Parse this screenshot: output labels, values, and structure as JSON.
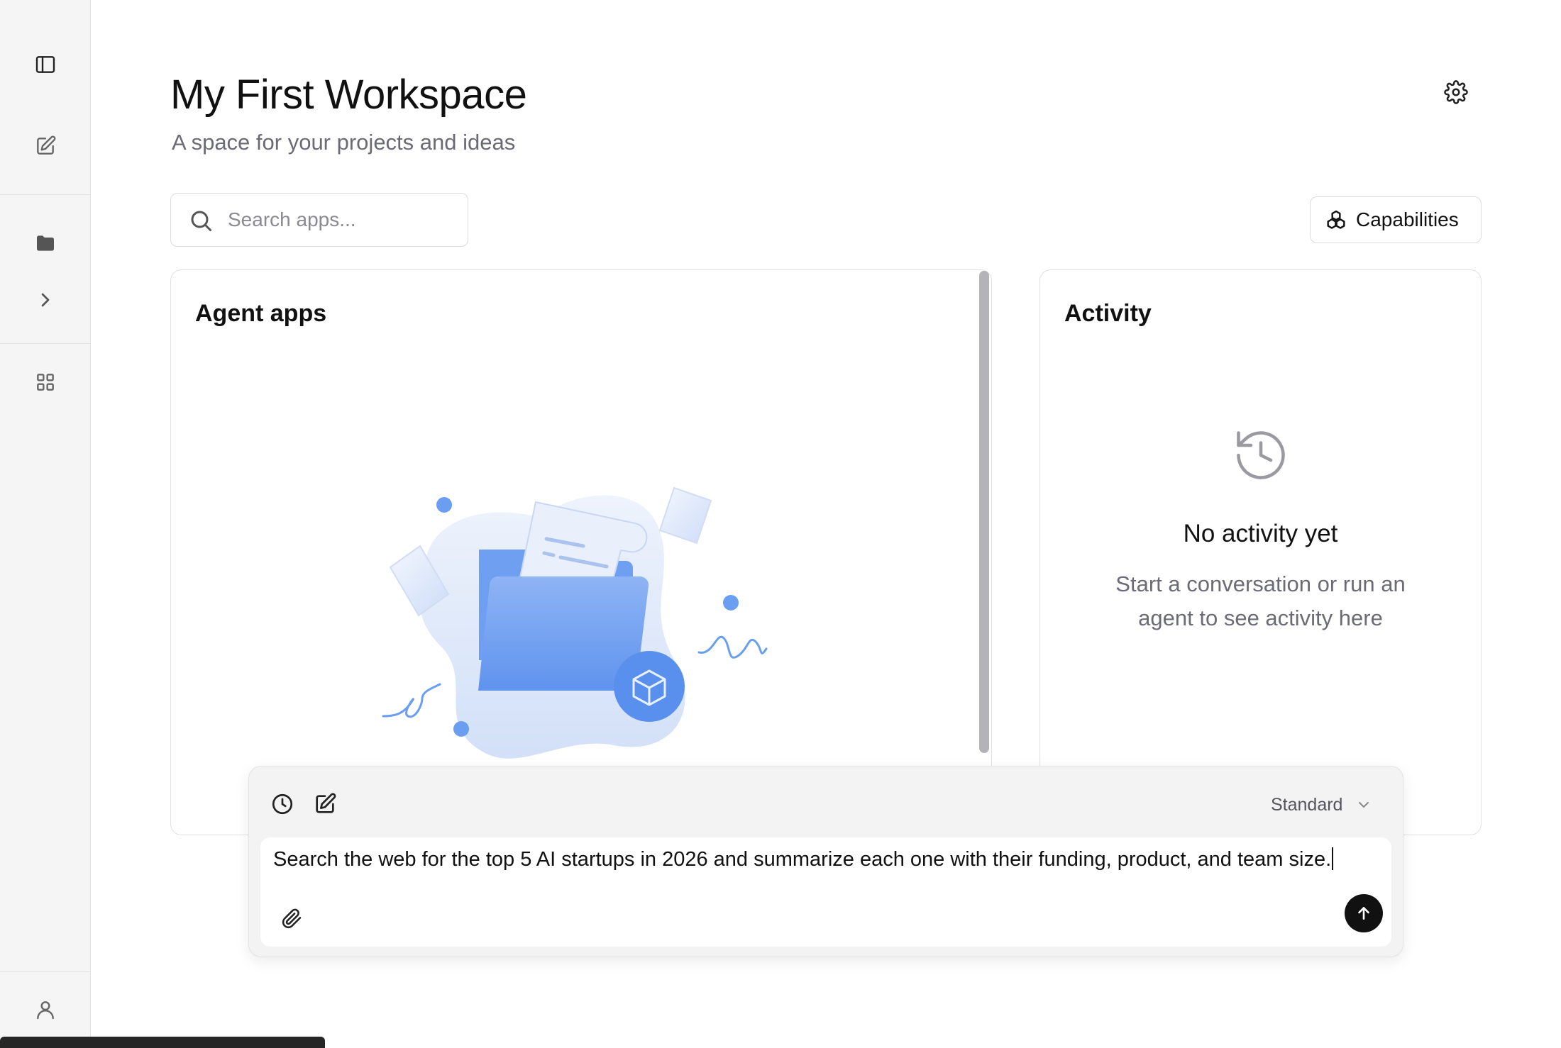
{
  "sidebar": {
    "items": [
      {
        "name": "toggle-sidebar",
        "icon": "panel-left-icon"
      },
      {
        "name": "new-chat",
        "icon": "edit-icon"
      },
      {
        "name": "folders",
        "icon": "folder-icon"
      },
      {
        "name": "expand",
        "icon": "chevron-right-icon"
      },
      {
        "name": "apps",
        "icon": "grid-icon"
      },
      {
        "name": "account",
        "icon": "user-icon"
      }
    ]
  },
  "header": {
    "title": "My First Workspace",
    "subtitle": "A space for your projects and ideas",
    "settings_icon": "gear-icon"
  },
  "search": {
    "placeholder": "Search apps...",
    "value": ""
  },
  "capabilities": {
    "label": "Capabilities",
    "icon": "blocks-icon"
  },
  "agent_apps": {
    "title": "Agent apps"
  },
  "activity": {
    "title": "Activity",
    "icon": "history-icon",
    "empty_title": "No activity yet",
    "empty_description": "Start a conversation or run an agent to see activity here"
  },
  "composer": {
    "mode": "Standard",
    "prompt": "Search the web for the top 5 AI startups in 2026 and summarize each one with their funding, product, and team size.",
    "icons": [
      "clock-icon",
      "edit-icon",
      "chevron-down-icon",
      "paperclip-icon",
      "arrow-up-icon"
    ]
  },
  "colors": {
    "accent": "#6b9cf0",
    "send_button": "#111111",
    "sidebar_bg": "#f5f5f5"
  }
}
